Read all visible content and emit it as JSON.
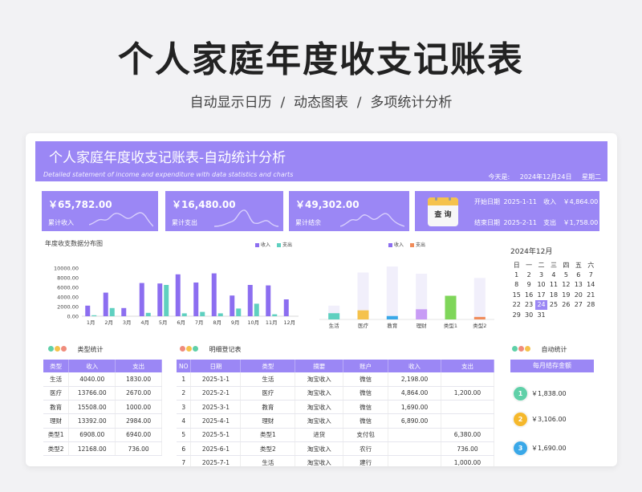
{
  "page": {
    "main_title": "个人家庭年度收支记账表",
    "sub_title": "自动显示日历  /  动态图表  /  多项统计分析"
  },
  "header": {
    "title": "个人家庭年度收支记账表-自动统计分析",
    "subtitle_en": "Detailed statement of income and expenditure with data statistics and charts",
    "today_label": "今天是:",
    "today_date": "2024年12月24日",
    "weekday": "星期二"
  },
  "summary": {
    "income_amount": "￥65,782.00",
    "income_label": "累计收入",
    "expense_amount": "￥16,480.00",
    "expense_label": "累计支出",
    "balance_amount": "￥49,302.00",
    "balance_label": "累计结余"
  },
  "query": {
    "button_label": "查 询",
    "start_label": "开始日期",
    "start_date": "2025-1-11",
    "end_label": "结束日期",
    "end_date": "2025-2-11",
    "income_label": "收入",
    "income_value": "￥4,864.00",
    "expense_label": "支出",
    "expense_value": "￥1,758.00"
  },
  "colors": {
    "accent": "#9b87f5",
    "income": "#8c6ef0",
    "expense": "#5fd0c0",
    "dot_red": "#f08c7c",
    "dot_yellow": "#f5c24c",
    "dot_green": "#5fd0a8"
  },
  "chart_data": [
    {
      "type": "bar",
      "title": "年度收支数据分布图",
      "categories": [
        "1月",
        "2月",
        "3月",
        "4月",
        "5月",
        "6月",
        "7月",
        "8月",
        "9月",
        "10月",
        "11月",
        "12月"
      ],
      "series": [
        {
          "name": "收入",
          "values": [
            2200,
            4900,
            1700,
            6900,
            6800,
            8700,
            7000,
            8900,
            4300,
            6500,
            6400,
            3500
          ]
        },
        {
          "name": "支出",
          "values": [
            200,
            1700,
            0,
            700,
            6500,
            600,
            900,
            600,
            1600,
            2600,
            400,
            0
          ]
        }
      ],
      "yticks": [
        "0.00",
        "2000.00",
        "4000.00",
        "6000.00",
        "8000.00",
        "10000.00"
      ],
      "ylim": [
        0,
        10000
      ],
      "legend": "top-right"
    },
    {
      "type": "bar",
      "categories": [
        "生活",
        "医疗",
        "教育",
        "理财",
        "类型1",
        "类型2"
      ],
      "series": [
        {
          "name": "收入",
          "values": [
            4040,
            13766,
            15508,
            13392,
            6908,
            12168
          ]
        },
        {
          "name": "支出",
          "values": [
            1830,
            2670,
            1000,
            2984,
            6940,
            736
          ]
        }
      ],
      "bar_colors": [
        "#5fd0c0",
        "#f5c24c",
        "#3aa8e8",
        "#c89cf5",
        "#7fd65a",
        "#f08c5a"
      ],
      "legend": "top-center"
    }
  ],
  "calendar": {
    "title": "2024年12月",
    "weekdays": [
      "日",
      "一",
      "二",
      "三",
      "四",
      "五",
      "六"
    ],
    "rows": [
      [
        "1",
        "2",
        "3",
        "4",
        "5",
        "6",
        "7"
      ],
      [
        "8",
        "9",
        "10",
        "11",
        "12",
        "13",
        "14"
      ],
      [
        "15",
        "16",
        "17",
        "18",
        "19",
        "20",
        "21"
      ],
      [
        "22",
        "23",
        "24",
        "25",
        "26",
        "27",
        "28"
      ],
      [
        "29",
        "30",
        "31",
        "",
        "",
        "",
        ""
      ]
    ],
    "today": "24"
  },
  "type_stats": {
    "title": "类型统计",
    "headers": [
      "类型",
      "收入",
      "支出"
    ],
    "rows": [
      [
        "生活",
        "4040.00",
        "1830.00"
      ],
      [
        "医疗",
        "13766.00",
        "2670.00"
      ],
      [
        "教育",
        "15508.00",
        "1000.00"
      ],
      [
        "理财",
        "13392.00",
        "2984.00"
      ],
      [
        "类型1",
        "6908.00",
        "6940.00"
      ],
      [
        "类型2",
        "12168.00",
        "736.00"
      ]
    ]
  },
  "ledger": {
    "title": "明细登记表",
    "headers": [
      "NO",
      "日期",
      "类型",
      "摘要",
      "账户",
      "收入",
      "支出"
    ],
    "rows": [
      [
        "1",
        "2025-1-1",
        "生活",
        "淘宝收入",
        "微信",
        "2,198.00",
        ""
      ],
      [
        "2",
        "2025-2-1",
        "医疗",
        "淘宝收入",
        "微信",
        "4,864.00",
        "1,200.00"
      ],
      [
        "3",
        "2025-3-1",
        "教育",
        "淘宝收入",
        "微信",
        "1,690.00",
        ""
      ],
      [
        "4",
        "2025-4-1",
        "理财",
        "淘宝收入",
        "微信",
        "6,890.00",
        ""
      ],
      [
        "5",
        "2025-5-1",
        "类型1",
        "进货",
        "支付包",
        "",
        "6,380.00"
      ],
      [
        "6",
        "2025-6-1",
        "类型2",
        "淘宝收入",
        "农行",
        "",
        "736.00"
      ],
      [
        "7",
        "2025-7-1",
        "生活",
        "淘宝收入",
        "建行",
        "",
        "1,000.00"
      ]
    ]
  },
  "auto_stats": {
    "title": "自动统计",
    "month_save_label": "每月结存金额",
    "items": [
      {
        "num": "1",
        "value": "￥1,838.00",
        "color": "#5fd0a8"
      },
      {
        "num": "2",
        "value": "￥3,106.00",
        "color": "#f5b82c"
      },
      {
        "num": "3",
        "value": "￥1,690.00",
        "color": "#3aa8e8"
      }
    ]
  }
}
